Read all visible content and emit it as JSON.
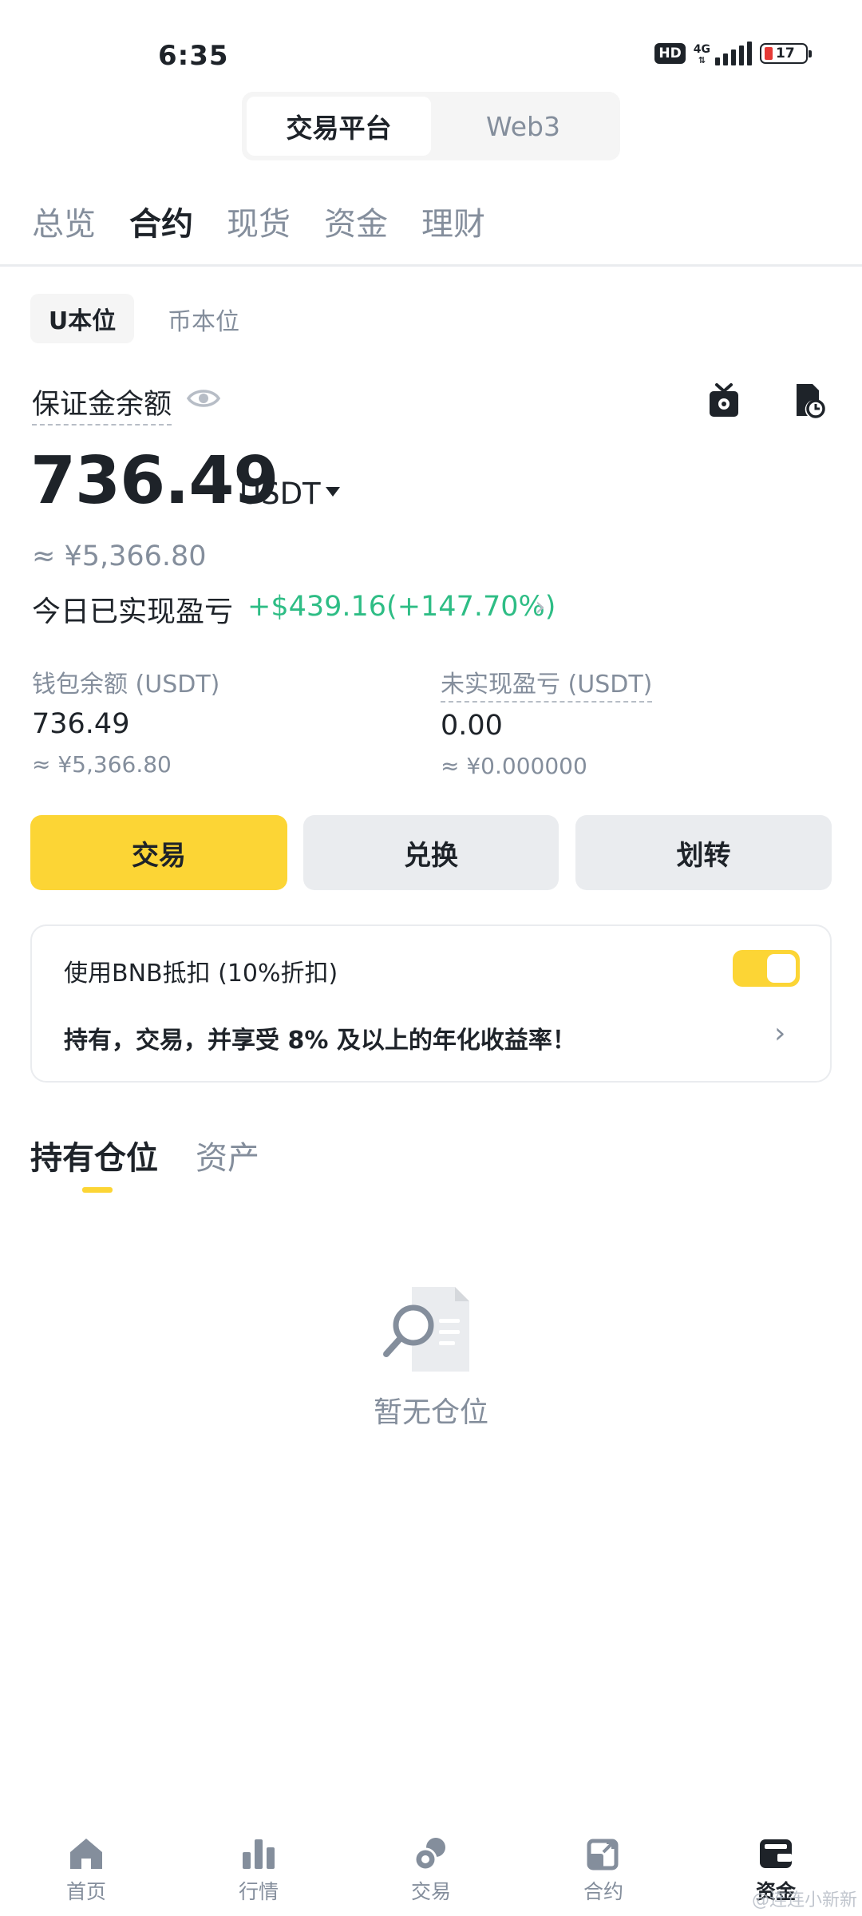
{
  "status_bar": {
    "time": "6:35",
    "hd": "HD",
    "network": "4G",
    "battery": "17"
  },
  "platform_switch": {
    "active": "交易平台",
    "inactive": "Web3"
  },
  "top_tabs": [
    "总览",
    "合约",
    "现货",
    "资金",
    "理财"
  ],
  "top_tab_active_index": 1,
  "sub_tabs": {
    "active": "U本位",
    "inactive": "币本位"
  },
  "margin": {
    "label": "保证金余额",
    "balance": "736.49",
    "unit": "USDT",
    "cny_approx": "≈ ¥5,366.80",
    "pnl_label": "今日已实现盈亏",
    "pnl_value": "+$439.16(+147.70%)",
    "pnl_chevron": "›"
  },
  "stats": {
    "wallet_label": "钱包余额 (USDT)",
    "wallet_value": "736.49",
    "wallet_cny": "≈ ¥5,366.80",
    "unrealized_label": "未实现盈亏 (USDT)",
    "unrealized_value": "0.00",
    "unrealized_cny": "≈ ¥0.000000"
  },
  "actions": {
    "trade": "交易",
    "convert": "兑换",
    "transfer": "划转"
  },
  "bnb_card": {
    "title": "使用BNB抵扣 (10%折扣)",
    "toggle_on": true,
    "promo": "持有，交易，并享受 8% 及以上的年化收益率！",
    "chevron": "›"
  },
  "positions": {
    "tab_active": "持有仓位",
    "tab_inactive": "资产",
    "empty_text": "暂无仓位"
  },
  "bottom_nav": [
    {
      "label": "首页",
      "icon": "home-icon"
    },
    {
      "label": "行情",
      "icon": "market-chart-icon"
    },
    {
      "label": "交易",
      "icon": "trade-icon"
    },
    {
      "label": "合约",
      "icon": "futures-icon"
    },
    {
      "label": "资金",
      "icon": "wallet-icon"
    }
  ],
  "bottom_nav_active_index": 4,
  "watermark": "@连连小新新",
  "colors": {
    "accent": "#fcd535",
    "profit": "#2ebd85",
    "text_primary": "#1e2329",
    "text_secondary": "#848e9c"
  }
}
